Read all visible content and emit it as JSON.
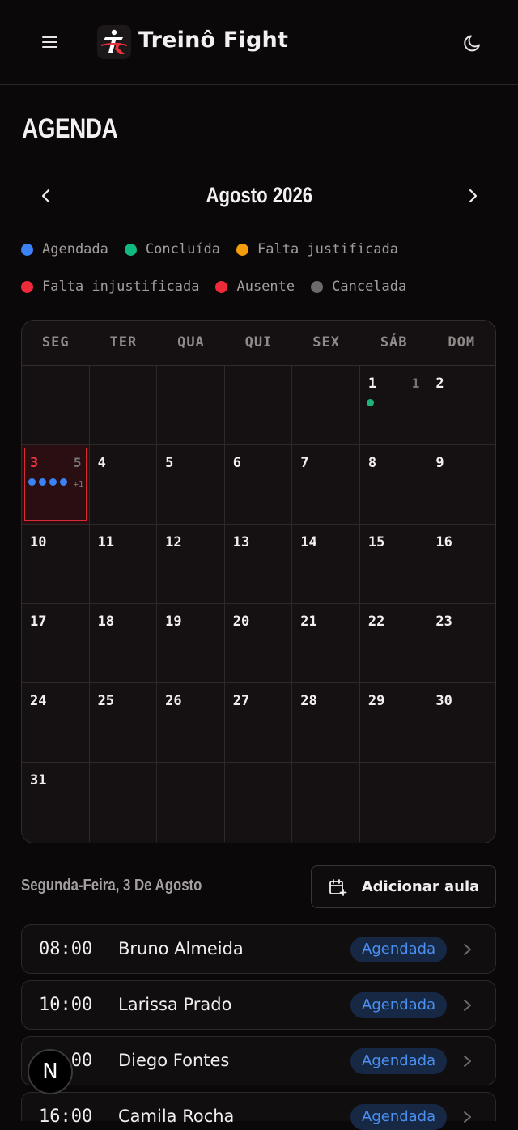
{
  "app": {
    "brand": "Treinô Fight"
  },
  "icons": {
    "menu": "menu-icon",
    "theme": "moon-icon",
    "prev": "chevron-left-icon",
    "next": "chevron-right-icon",
    "add": "calendar-plus-icon",
    "row": "chevron-right-icon"
  },
  "page": {
    "title": "AGENDA"
  },
  "calendar": {
    "month_label": "Agosto 2026",
    "weekdays": [
      "SEG",
      "TER",
      "QUA",
      "QUI",
      "SEX",
      "SÁB",
      "DOM"
    ],
    "leading_blank_days": 5,
    "days_in_month": 31,
    "selected_day": 3,
    "day_info": {
      "1": {
        "count": "1",
        "dots": [
          "#1db47a"
        ],
        "more": ""
      },
      "3": {
        "count": "5",
        "dots": [
          "#3b82f6",
          "#3b82f6",
          "#3b82f6",
          "#3b82f6"
        ],
        "more": "+1"
      }
    }
  },
  "legend": [
    {
      "label": "Agendada",
      "color": "#3b82f6"
    },
    {
      "label": "Concluída",
      "color": "#10b981"
    },
    {
      "label": "Falta justificada",
      "color": "#f59e0b"
    },
    {
      "label": "Falta injustificada",
      "color": "#ef2b3b"
    },
    {
      "label": "Ausente",
      "color": "#ef2b3b"
    },
    {
      "label": "Cancelada",
      "color": "#6b6b6b"
    }
  ],
  "day_panel": {
    "date_label": "Segunda-Feira, 3 De Agosto",
    "add_button_label": "Adicionar aula"
  },
  "sessions": [
    {
      "time": "08:00",
      "name": "Bruno Almeida",
      "status": "Agendada"
    },
    {
      "time": "10:00",
      "name": "Larissa Prado",
      "status": "Agendada"
    },
    {
      "time": "14:00",
      "name": "Diego Fontes",
      "status": "Agendada"
    },
    {
      "time": "16:00",
      "name": "Camila Rocha",
      "status": "Agendada"
    }
  ],
  "fab": {
    "label": "N"
  }
}
